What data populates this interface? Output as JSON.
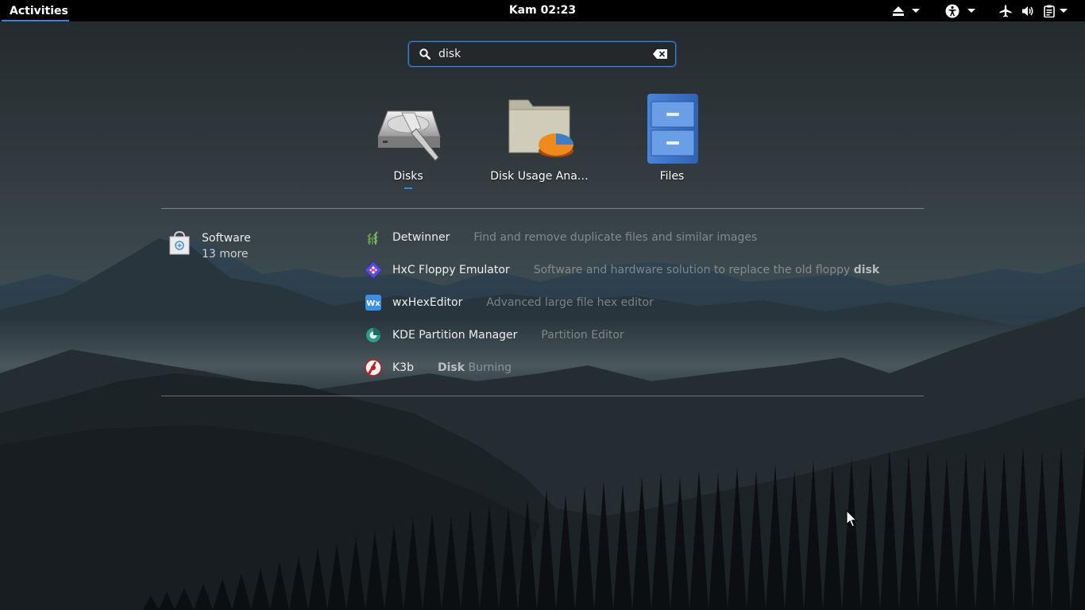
{
  "topbar": {
    "activities_label": "Activities",
    "clock": "Kam 02:23",
    "icons": [
      "eject-icon",
      "accessibility-icon",
      "airplane-mode-icon",
      "volume-icon",
      "clipboard-icon"
    ]
  },
  "search": {
    "value": "disk",
    "placeholder": ""
  },
  "apps": [
    {
      "label": "Disks",
      "icon": "disks-icon",
      "running": true
    },
    {
      "label": "Disk Usage Ana…",
      "icon": "disk-usage-analyzer-icon",
      "running": false
    },
    {
      "label": "Files",
      "icon": "files-cabinet-icon",
      "running": false
    }
  ],
  "provider": {
    "name": "Software",
    "more": "13 more",
    "icon": "software-bag-icon"
  },
  "results": [
    {
      "name": "Detwinner",
      "desc_pre": "Find and remove duplicate files and similar images",
      "desc_bold": "",
      "desc_post": "",
      "icon": "detwinner-icon"
    },
    {
      "name": "HxC Floppy Emulator",
      "desc_pre": "Software and hardware solution to replace the old floppy ",
      "desc_bold": "disk",
      "desc_post": "",
      "icon": "hxc-floppy-icon"
    },
    {
      "name": "wxHexEditor",
      "desc_pre": "Advanced large file hex editor",
      "desc_bold": "",
      "desc_post": "",
      "icon": "wxhexeditor-icon"
    },
    {
      "name": "KDE Partition Manager",
      "desc_pre": "Partition Editor",
      "desc_bold": "",
      "desc_post": "",
      "icon": "partition-manager-icon"
    },
    {
      "name": "K3b",
      "desc_pre": "",
      "desc_bold": "Disk",
      "desc_post": " Burning",
      "icon": "k3b-icon"
    }
  ],
  "colors": {
    "accent": "#3584e4",
    "topbar": "#000000"
  }
}
